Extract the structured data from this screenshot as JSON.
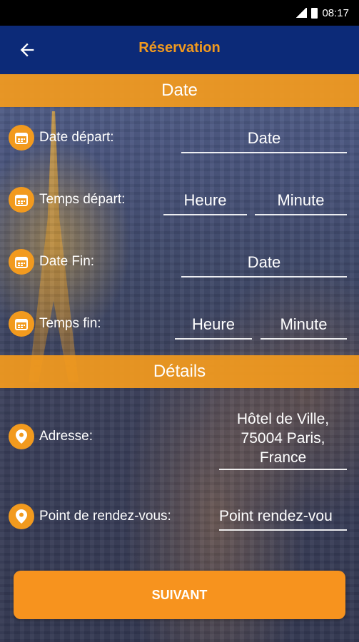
{
  "status_bar": {
    "time": "08:17"
  },
  "app_bar": {
    "title": "Réservation",
    "back_icon": "arrow-left-icon"
  },
  "sections": {
    "date": {
      "title": "Date"
    },
    "details": {
      "title": "Détails"
    }
  },
  "form": {
    "date_depart": {
      "label": "Date départ:",
      "value": "Date"
    },
    "temps_depart": {
      "label": "Temps départ:",
      "hour": "Heure",
      "minute": "Minute"
    },
    "date_fin": {
      "label": "Date Fin:",
      "value": "Date"
    },
    "temps_fin": {
      "label": "Temps fin:",
      "hour": "Heure",
      "minute": "Minute"
    },
    "adresse": {
      "label": "Adresse:",
      "line1": "Hôtel de Ville,",
      "line2": "75004 Paris,",
      "line3": "France"
    },
    "point": {
      "label": "Point de rendez-vous:",
      "value": "Point rendez-vou"
    }
  },
  "submit": {
    "label": "SUIVANT"
  },
  "colors": {
    "accent": "#f29a1e",
    "app_bar": "#0c2a78"
  }
}
